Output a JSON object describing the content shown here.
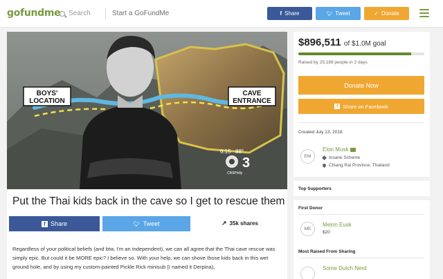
{
  "header": {
    "logo": "gofundme",
    "search_placeholder": "Search",
    "start_link": "Start a GoFundMe",
    "share_label": "Share",
    "tweet_label": "Tweet",
    "donate_label": "Donate"
  },
  "hero": {
    "label_boys": "BOYS'\nLOCATION",
    "label_cave": "CAVE\nENTRANCE",
    "timestamp": "6:15",
    "temperature": "88°",
    "channel": "3",
    "station": "CBSPhilly"
  },
  "campaign": {
    "title": "Put the Thai kids back in the cave so I get to rescue them",
    "share_label": "Share",
    "tweet_label": "Tweet",
    "shares_count": "35k shares",
    "description": "Regardless of your political beliefs (and btw, I'm an independent), we can all agree that the Thai cave rescue was simply epic. But could it be MORE epic? I believe so. With your help, we can shove those kids back in this wet ground hole, and by using my custom-painted Pickle Rick minisub (I named it Derpina),"
  },
  "funding": {
    "raised": "$896,511",
    "goal_text": "of $1.0M goal",
    "progress": 0.8965,
    "raised_by": "Raised by 25,189 people in 2 days",
    "donate_now": "Donate Now",
    "share_facebook": "Share on Facebook",
    "created": "Created July 13, 2018"
  },
  "organizer": {
    "initials": "EM",
    "name": "Elon Musk",
    "category": "Insane Scheme",
    "location": "Chiang Rai Province, Thailand"
  },
  "supporters": {
    "top_heading": "Top Supporters",
    "first_heading": "First Donor",
    "first_initials": "ME",
    "first_name": "Melon Eusk",
    "first_amount": "$20",
    "sharing_heading": "Most Raised From Sharing",
    "sharing_name": "Some Dutch Nerd"
  },
  "colors": {
    "brand_green": "#7a9a42",
    "facebook_blue": "#3b5998",
    "twitter_blue": "#5aa6e6",
    "donate_orange": "#f0a732"
  }
}
